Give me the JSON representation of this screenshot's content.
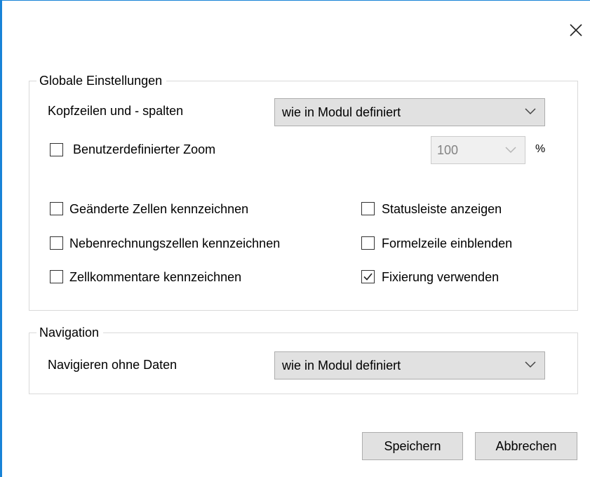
{
  "global_group": {
    "legend": "Globale Einstellungen",
    "header_label": "Kopfzeilen und - spalten",
    "header_select_value": "wie in Modul definiert",
    "zoom_checkbox_label": "Benutzerdefinierter Zoom",
    "zoom_checked": false,
    "zoom_value": "100",
    "zoom_unit": "%",
    "options": [
      {
        "label": "Geänderte Zellen kennzeichnen",
        "checked": false
      },
      {
        "label": "Nebenrechnungszellen kennzeichnen",
        "checked": false
      },
      {
        "label": "Zellkommentare kennzeichnen",
        "checked": false
      },
      {
        "label": "Statusleiste anzeigen",
        "checked": false
      },
      {
        "label": "Formelzeile einblenden",
        "checked": false
      },
      {
        "label": "Fixierung verwenden",
        "checked": true
      }
    ]
  },
  "navigation_group": {
    "legend": "Navigation",
    "label": "Navigieren ohne Daten",
    "select_value": "wie in Modul definiert"
  },
  "buttons": {
    "save": "Speichern",
    "cancel": "Abbrechen"
  },
  "colors": {
    "window_border": "#1883d7",
    "group_border": "#d9d9d9",
    "button_background": "#e1e1e1"
  },
  "icons": [
    "close-icon",
    "chevron-down-icon",
    "checkmark-icon"
  ]
}
